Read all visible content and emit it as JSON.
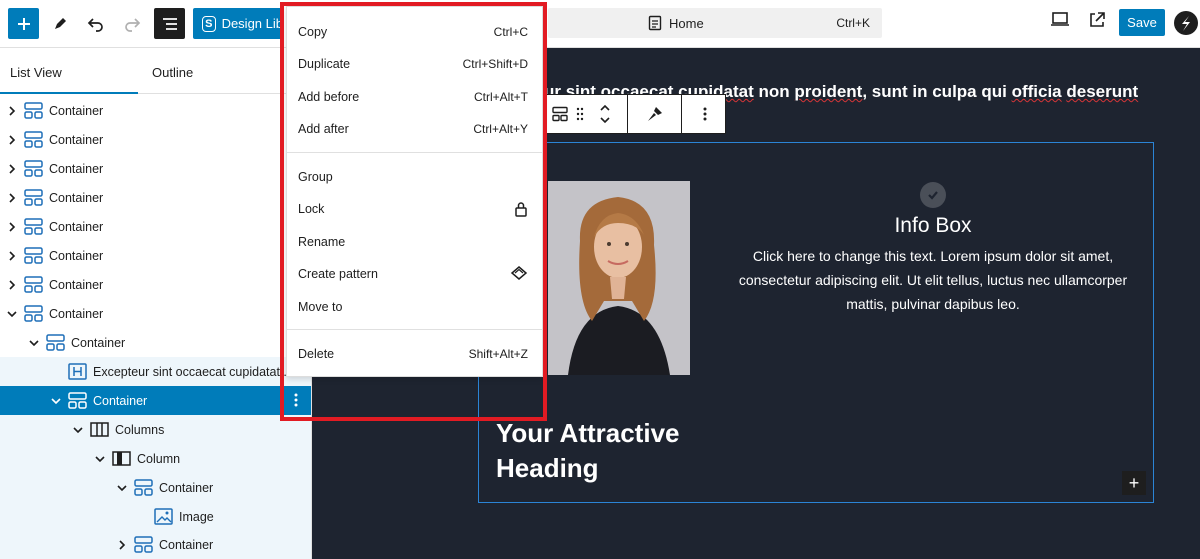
{
  "colors": {
    "accent": "#007cba",
    "canvas_bg": "#1e2430",
    "highlight_border": "#e21b23"
  },
  "toolbar": {
    "add_icon": "plus-icon",
    "tools_icon": "pen-icon",
    "undo_icon": "undo-icon",
    "redo_icon": "redo-icon",
    "list_view_icon": "list-view-icon",
    "design_library_label": "Design Lib",
    "command": {
      "page": "Home",
      "shortcut": "Ctrl+K"
    },
    "save_label": "Save"
  },
  "sidebar": {
    "tabs": [
      "List View",
      "Outline"
    ],
    "rows": [
      {
        "label": "Container"
      },
      {
        "label": "Container"
      },
      {
        "label": "Container"
      },
      {
        "label": "Container"
      },
      {
        "label": "Container"
      },
      {
        "label": "Container"
      },
      {
        "label": "Container"
      },
      {
        "label": "Container"
      },
      {
        "label": "Container"
      },
      {
        "label": "Excepteur sint occaecat cupidatat ..."
      },
      {
        "label": "Container"
      },
      {
        "label": "Columns"
      },
      {
        "label": "Column"
      },
      {
        "label": "Container"
      },
      {
        "label": "Image"
      },
      {
        "label": "Container"
      }
    ]
  },
  "menu": {
    "items": [
      {
        "label": "Copy",
        "shortcut": "Ctrl+C"
      },
      {
        "label": "Duplicate",
        "shortcut": "Ctrl+Shift+D"
      },
      {
        "label": "Add before",
        "shortcut": "Ctrl+Alt+T"
      },
      {
        "label": "Add after",
        "shortcut": "Ctrl+Alt+Y"
      },
      {
        "label": "Group",
        "shortcut": ""
      },
      {
        "label": "Lock",
        "shortcut": "",
        "icon": "lock-icon"
      },
      {
        "label": "Rename",
        "shortcut": ""
      },
      {
        "label": "Create pattern",
        "shortcut": "",
        "icon": "pattern-icon"
      },
      {
        "label": "Move to",
        "shortcut": ""
      },
      {
        "label": "Delete",
        "shortcut": "Shift+Alt+Z"
      }
    ]
  },
  "canvas": {
    "paragraph_prefix": "ur sint occaecat ",
    "paragraph_squiggle_1": "cupidatat",
    "paragraph_mid": " non ",
    "paragraph_squiggle_2": "proident",
    "paragraph_suffix": ", sunt in culpa qui ",
    "paragraph_squiggle_3": "officia",
    "paragraph_squiggle_4": "deserunt",
    "info_title": "Info Box",
    "info_text": "Click here to change this text. Lorem ipsum dolor sit amet, consectetur adipiscing elit. Ut elit tellus, luctus nec ullamcorper mattis, pulvinar dapibus leo.",
    "heading_line1": "Your Attractive",
    "heading_line2": "Heading",
    "plus": "+"
  }
}
